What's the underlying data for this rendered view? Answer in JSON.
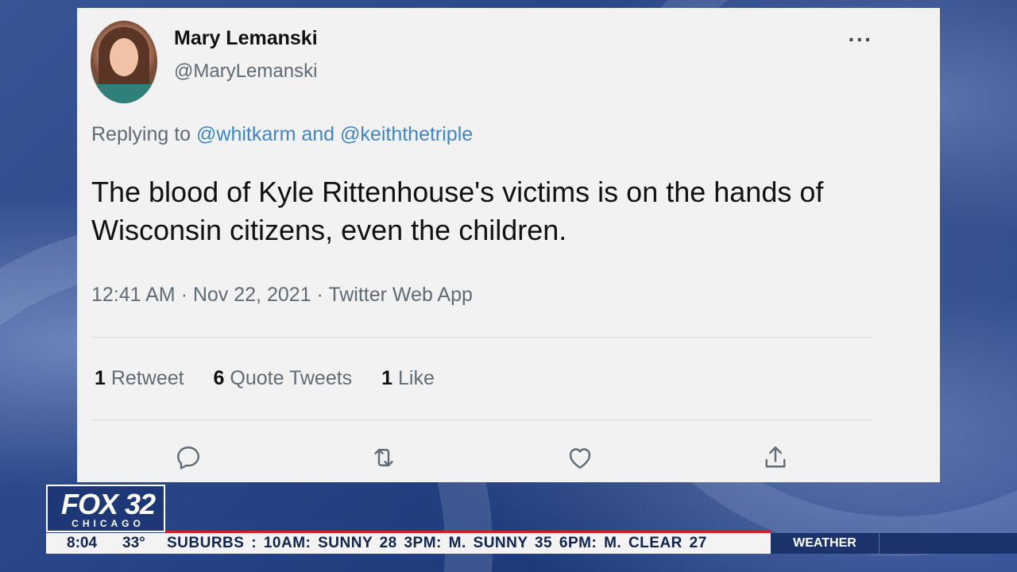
{
  "tweet": {
    "name": "Mary Lemanski",
    "handle": "@MaryLemanski",
    "more_label": "···",
    "replying_prefix": "Replying to",
    "reply_user_1": "@whitkarm",
    "reply_and": "and",
    "reply_user_2": "@keiththetriple",
    "text": "The blood of Kyle Rittenhouse's victims is on the hands of Wisconsin citizens, even the children.",
    "meta": "12:41 AM · Nov 22, 2021 · Twitter Web App",
    "stats": {
      "retweets_count": "1",
      "retweets_label": "Retweet",
      "quotes_count": "6",
      "quotes_label": "Quote Tweets",
      "likes_count": "1",
      "likes_label": "Like"
    },
    "actions": [
      "reply-icon",
      "retweet-icon",
      "like-icon",
      "share-icon"
    ]
  },
  "broadcast": {
    "logo_main": "FOX 32",
    "logo_sub": "CHICAGO",
    "time": "8:04",
    "temperature": "33°",
    "ticker_text": "SUBURBS : 10AM: SUNNY 28 3PM: M. SUNNY 35 6PM: M. CLEAR 27",
    "weather_label": "WEATHER",
    "colors": {
      "brand": "#1e3877",
      "accent_line": "#d21f2a",
      "ticker_text": "#10244f"
    }
  }
}
